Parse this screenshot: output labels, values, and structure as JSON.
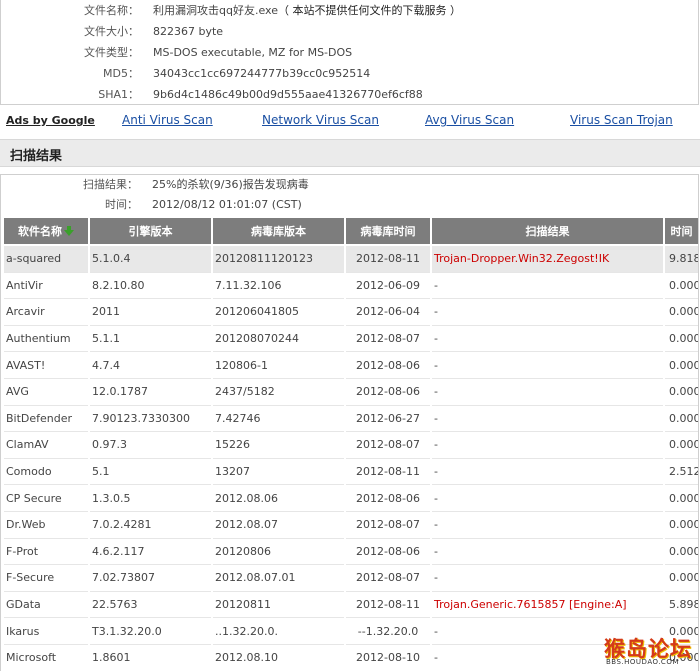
{
  "file_info": {
    "rows": [
      {
        "label": "文件名称：",
        "value": "利用漏洞攻击qq好友.exe",
        "notice": "（ 本站不提供任何文件的下载服务 ）"
      },
      {
        "label": "文件大小：",
        "value": "822367 byte"
      },
      {
        "label": "文件类型：",
        "value": "MS-DOS executable, MZ for MS-DOS"
      },
      {
        "label": "MD5：",
        "value": "34043cc1cc697244777b39cc0c952514"
      },
      {
        "label": "SHA1：",
        "value": "9b6d4c1486c49b00d9d555aae41326770ef6cf88"
      }
    ]
  },
  "links": {
    "ads": "Ads by Google",
    "items": [
      "Anti Virus Scan",
      "Network Virus Scan",
      "Avg Virus Scan",
      "Virus Scan Trojan"
    ]
  },
  "section_title": "扫描结果",
  "summary": {
    "result_label": "扫描结果：",
    "result_value": "25%的杀软(9/36)报告发现病毒",
    "time_label": "时间：",
    "time_value": "2012/08/12 01:01:07 (CST)"
  },
  "table": {
    "headers": [
      "软件名称",
      "引擎版本",
      "病毒库版本",
      "病毒库时间",
      "扫描结果",
      "时间"
    ],
    "rows": [
      {
        "name": "a-squared",
        "engine": "5.1.0.4",
        "db": "20120811120123",
        "date": "2012-08-11",
        "result": "Trojan-Dropper.Win32.Zegost!IK",
        "time": "9.818",
        "infected": true
      },
      {
        "name": "AntiVir",
        "engine": "8.2.10.80",
        "db": "7.11.32.106",
        "date": "2012-06-09",
        "result": "-",
        "time": "0.000",
        "infected": false
      },
      {
        "name": "Arcavir",
        "engine": "2011",
        "db": "201206041805",
        "date": "2012-06-04",
        "result": "-",
        "time": "0.000",
        "infected": false
      },
      {
        "name": "Authentium",
        "engine": "5.1.1",
        "db": "201208070244",
        "date": "2012-08-07",
        "result": "-",
        "time": "0.000",
        "infected": false
      },
      {
        "name": "AVAST!",
        "engine": "4.7.4",
        "db": "120806-1",
        "date": "2012-08-06",
        "result": "-",
        "time": "0.000",
        "infected": false
      },
      {
        "name": "AVG",
        "engine": "12.0.1787",
        "db": "2437/5182",
        "date": "2012-08-06",
        "result": "-",
        "time": "0.000",
        "infected": false
      },
      {
        "name": "BitDefender",
        "engine": "7.90123.7330300",
        "db": "7.42746",
        "date": "2012-06-27",
        "result": "-",
        "time": "0.000",
        "infected": false
      },
      {
        "name": "ClamAV",
        "engine": "0.97.3",
        "db": "15226",
        "date": "2012-08-07",
        "result": "-",
        "time": "0.000",
        "infected": false
      },
      {
        "name": "Comodo",
        "engine": "5.1",
        "db": "13207",
        "date": "2012-08-11",
        "result": "-",
        "time": "2.512",
        "infected": false
      },
      {
        "name": "CP Secure",
        "engine": "1.3.0.5",
        "db": "2012.08.06",
        "date": "2012-08-06",
        "result": "-",
        "time": "0.000",
        "infected": false
      },
      {
        "name": "Dr.Web",
        "engine": "7.0.2.4281",
        "db": "2012.08.07",
        "date": "2012-08-07",
        "result": "-",
        "time": "0.000",
        "infected": false
      },
      {
        "name": "F-Prot",
        "engine": "4.6.2.117",
        "db": "20120806",
        "date": "2012-08-06",
        "result": "-",
        "time": "0.000",
        "infected": false
      },
      {
        "name": "F-Secure",
        "engine": "7.02.73807",
        "db": "2012.08.07.01",
        "date": "2012-08-07",
        "result": "-",
        "time": "0.000",
        "infected": false
      },
      {
        "name": "GData",
        "engine": "22.5763",
        "db": "20120811",
        "date": "2012-08-11",
        "result": "Trojan.Generic.7615857 [Engine:A]",
        "time": "5.898",
        "infected": true
      },
      {
        "name": "Ikarus",
        "engine": "T3.1.32.20.0",
        "db": "..1.32.20.0.",
        "date": "--1.32.20.0",
        "result": "-",
        "time": "0.000",
        "infected": false
      },
      {
        "name": "Microsoft",
        "engine": "1.8601",
        "db": "2012.08.10",
        "date": "2012-08-10",
        "result": "-",
        "time": "0.000",
        "infected": false
      }
    ]
  },
  "watermark": {
    "text": "猴岛论坛",
    "sub": "BBS.HOUDAO.COM"
  },
  "colors": {
    "link": "#1a4fa3",
    "header_bg": "#7d7d7d",
    "infected": "#cc0000",
    "highlight_row": "#e8e8e8"
  }
}
